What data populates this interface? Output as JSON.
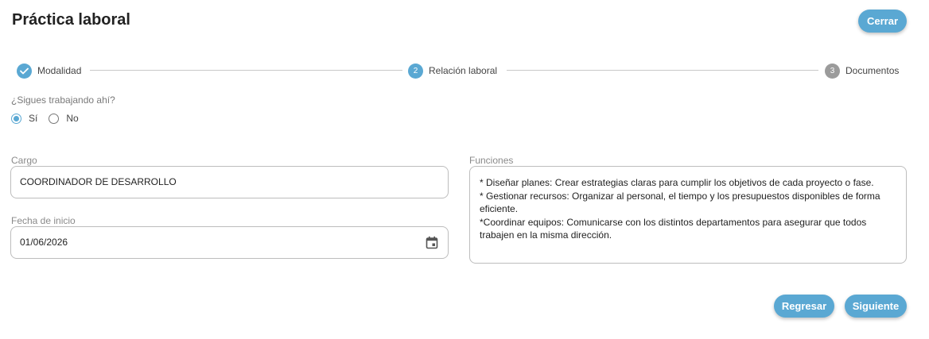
{
  "header": {
    "title": "Práctica laboral",
    "close_label": "Cerrar"
  },
  "stepper": {
    "steps": [
      {
        "number": "",
        "label": "Modalidad",
        "state": "done"
      },
      {
        "number": "2",
        "label": "Relación laboral",
        "state": "active"
      },
      {
        "number": "3",
        "label": "Documentos",
        "state": "pending"
      }
    ]
  },
  "question": {
    "label": "¿Sigues trabajando ahí?",
    "options": [
      {
        "label": "Sí",
        "selected": true
      },
      {
        "label": "No",
        "selected": false
      }
    ]
  },
  "form": {
    "cargo_label": "Cargo",
    "cargo_value": "COORDINADOR DE DESARROLLO",
    "fecha_label": "Fecha de inicio",
    "fecha_value": "01/06/2026",
    "funciones_label": "Funciones",
    "funciones_value": "* Diseñar planes: Crear estrategias claras para cumplir los objetivos de cada proyecto o fase.\n* Gestionar recursos: Organizar al personal, el tiempo y los presupuestos disponibles de forma eficiente.\n*Coordinar equipos: Comunicarse con los distintos departamentos para asegurar que todos trabajen en la misma dirección."
  },
  "footer": {
    "back_label": "Regresar",
    "next_label": "Siguiente"
  },
  "colors": {
    "accent": "#5aa8d3",
    "pending": "#9b9b9b"
  },
  "icons": {
    "step_done": "check-icon",
    "date_picker": "calendar-icon"
  }
}
